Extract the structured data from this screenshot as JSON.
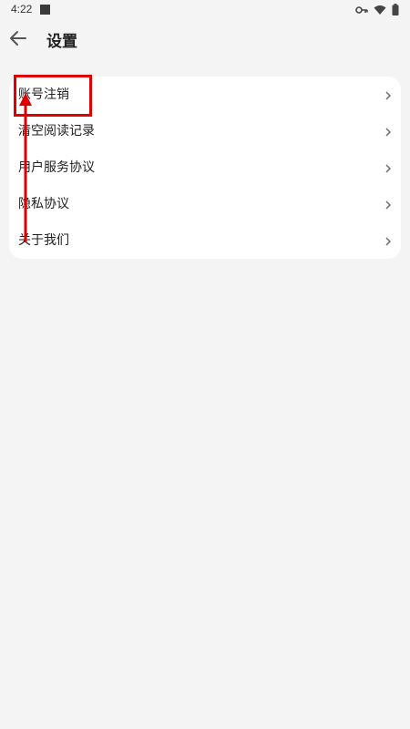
{
  "status_bar": {
    "time": "4:22"
  },
  "header": {
    "title": "设置"
  },
  "settings": {
    "items": [
      {
        "label": "账号注销"
      },
      {
        "label": "清空阅读记录"
      },
      {
        "label": "用户服务协议"
      },
      {
        "label": "隐私协议"
      },
      {
        "label": "关于我们"
      }
    ]
  },
  "icons": {
    "back": "arrow-left-icon",
    "chevron": "chevron-right-icon",
    "key": "key-icon",
    "wifi": "wifi-icon",
    "battery": "battery-icon"
  },
  "colors": {
    "background": "#f4f4f4",
    "card": "#ffffff",
    "annotation": "#e00000"
  }
}
